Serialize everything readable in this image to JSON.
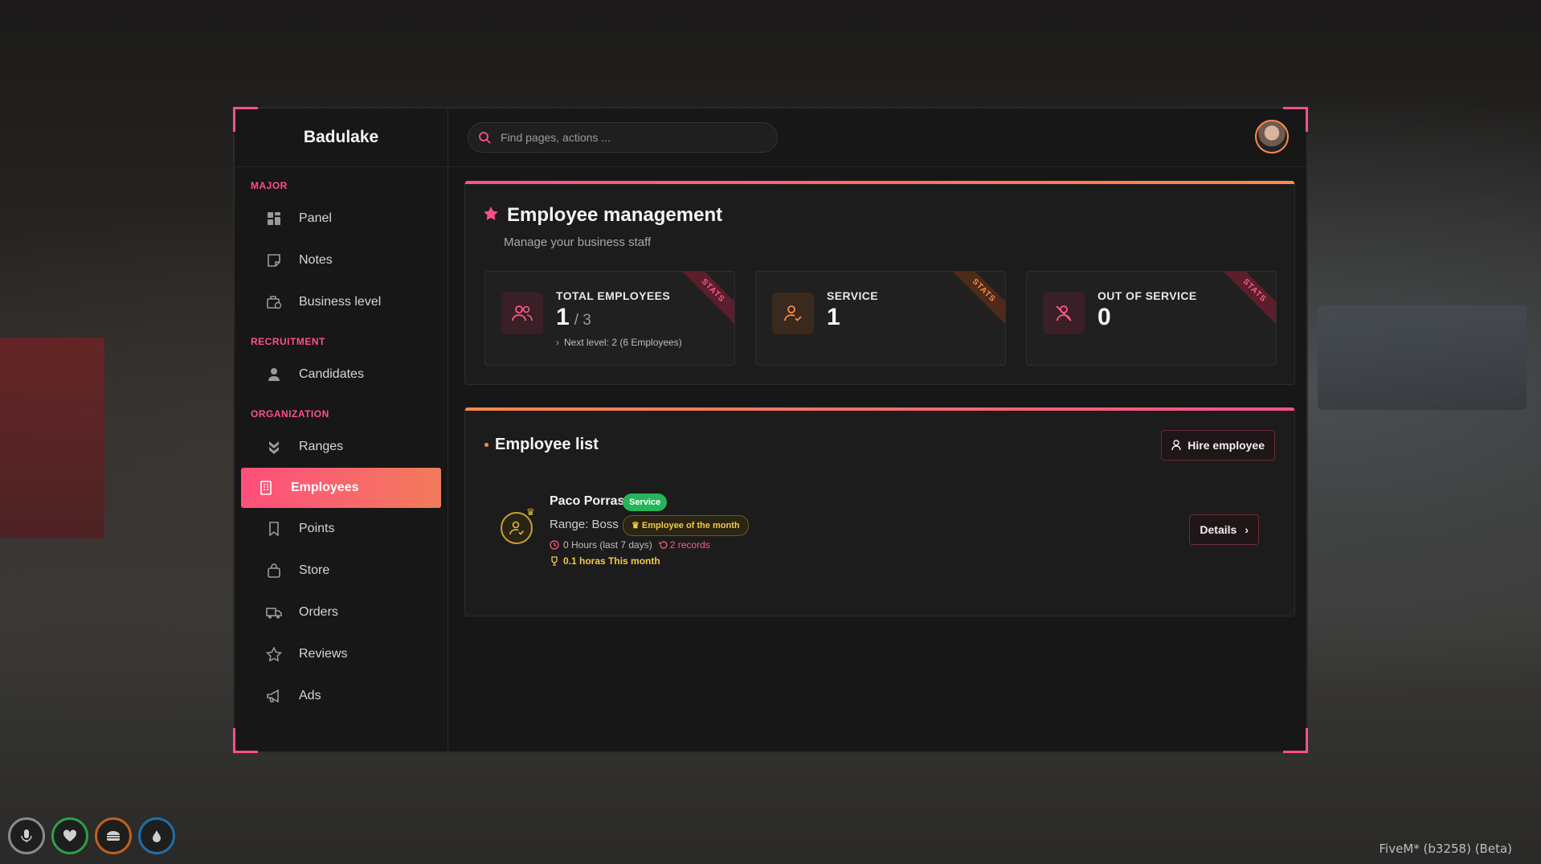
{
  "app": {
    "title": "Badulake"
  },
  "search": {
    "placeholder": "Find pages, actions ..."
  },
  "sidebar": {
    "sections": [
      {
        "title": "MAJOR",
        "items": [
          {
            "label": "Panel",
            "icon": "grid-icon"
          },
          {
            "label": "Notes",
            "icon": "note-icon"
          },
          {
            "label": "Business level",
            "icon": "level-icon"
          }
        ]
      },
      {
        "title": "RECRUITMENT",
        "items": [
          {
            "label": "Candidates",
            "icon": "user-icon"
          }
        ]
      },
      {
        "title": "ORGANIZATION",
        "items": [
          {
            "label": "Ranges",
            "icon": "chevrons-icon"
          },
          {
            "label": "Employees",
            "icon": "building-icon",
            "active": true
          },
          {
            "label": "Points",
            "icon": "bookmark-icon"
          },
          {
            "label": "Store",
            "icon": "bag-icon"
          },
          {
            "label": "Orders",
            "icon": "truck-icon"
          },
          {
            "label": "Reviews",
            "icon": "star-icon"
          },
          {
            "label": "Ads",
            "icon": "megaphone-icon"
          }
        ]
      }
    ]
  },
  "management": {
    "title": "Employee management",
    "subtitle": "Manage your business staff",
    "stats": [
      {
        "label": "TOTAL EMPLOYEES",
        "value": "1",
        "max": "/ 3",
        "next": "Next level: 2 (6 Employees)",
        "ribbon": "STATS"
      },
      {
        "label": "SERVICE",
        "value": "1",
        "ribbon": "STATS"
      },
      {
        "label": "OUT OF SERVICE",
        "value": "0",
        "ribbon": "STATS"
      }
    ]
  },
  "employee_list": {
    "title": "Employee list",
    "hire_label": "Hire employee",
    "employees": [
      {
        "name": "Paco Porras",
        "status": "Service",
        "range": "Range: Boss",
        "badge": "Employee of the month",
        "hours": "0 Hours (last 7 days)",
        "records": "2 records",
        "month": "0.1 horas This month",
        "details_label": "Details"
      }
    ]
  },
  "footer": {
    "version": "FiveM* (b3258) (Beta)"
  },
  "colors": {
    "accent": "#ff4f8b",
    "accent2": "#ff8a4a",
    "success": "#27b35a",
    "gold": "#f0c94a"
  }
}
